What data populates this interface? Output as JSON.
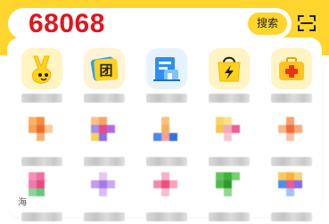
{
  "search": {
    "query": "68068",
    "button_label": "搜索"
  },
  "icons": [
    "app-mascot-icon",
    "group-buy-icon",
    "storefront-icon",
    "flash-shopping-bag-icon",
    "medical-kit-icon",
    "pixelated-icon",
    "pixelated-icon",
    "pixelated-icon",
    "pixelated-icon",
    "pixelated-icon",
    "pixelated-icon",
    "pixelated-icon",
    "pixelated-icon",
    "pixelated-icon",
    "pixelated-icon"
  ],
  "row1": {
    "tile2_char": "团"
  },
  "colors": {
    "brand_yellow": "#ffd52e",
    "query_red": "#e3141c"
  },
  "footer": {
    "partial_char": "海"
  }
}
